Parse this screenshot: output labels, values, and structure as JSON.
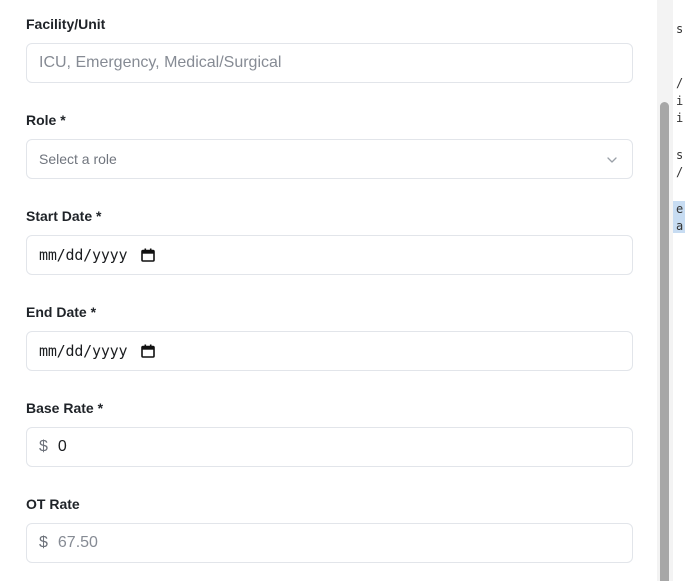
{
  "form": {
    "facility": {
      "label": "Facility/Unit",
      "placeholder": "ICU, Emergency, Medical/Surgical"
    },
    "role": {
      "label": "Role *",
      "value": "Select a role"
    },
    "start_date": {
      "label": "Start Date *",
      "value": "mm/dd/yyyy"
    },
    "end_date": {
      "label": "End Date *",
      "value": "mm/dd/yyyy"
    },
    "base_rate": {
      "label": "Base Rate *",
      "currency": "$",
      "value": "0"
    },
    "ot_rate": {
      "label": "OT Rate",
      "currency": "$",
      "placeholder": "67.50"
    }
  },
  "background_code": [
    "s",
    "/",
    "i",
    "i",
    "s",
    "/",
    "e",
    "a"
  ],
  "icons": {
    "role_dropdown": "chevron-down-icon",
    "calendar": "calendar-icon"
  }
}
